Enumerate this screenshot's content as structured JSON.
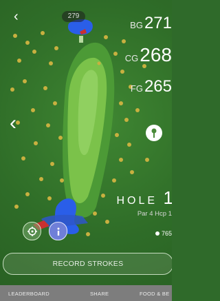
{
  "header": {
    "back_icon": "chevron-left-icon",
    "hole_number": "279"
  },
  "map": {
    "left_arrow_icon": "chevron-left-icon"
  },
  "distances": {
    "back": {
      "label": "BG",
      "value": "271"
    },
    "center": {
      "label": "CG",
      "value": "268"
    },
    "front": {
      "label": "FG",
      "value": "265"
    }
  },
  "pin_icon": "pin-icon",
  "hole": {
    "label": "HOLE",
    "number": "1",
    "par": "Par 4",
    "hcp": "Hcp 1",
    "yards": "765"
  },
  "buttons": {
    "target_icon": "crosshair-icon",
    "info_icon": "info-icon",
    "record_label": "RECORD STROKES"
  },
  "tabs": [
    {
      "label": "LEADERBOARD"
    },
    {
      "label": "SHARE"
    },
    {
      "label": "FOOD & BE"
    }
  ],
  "colors": {
    "rough": "#2f6a2a",
    "fairway": "#7bc24a",
    "green": "#8cd25a",
    "water": "#2a5ee8",
    "bunker": "#c83030"
  }
}
